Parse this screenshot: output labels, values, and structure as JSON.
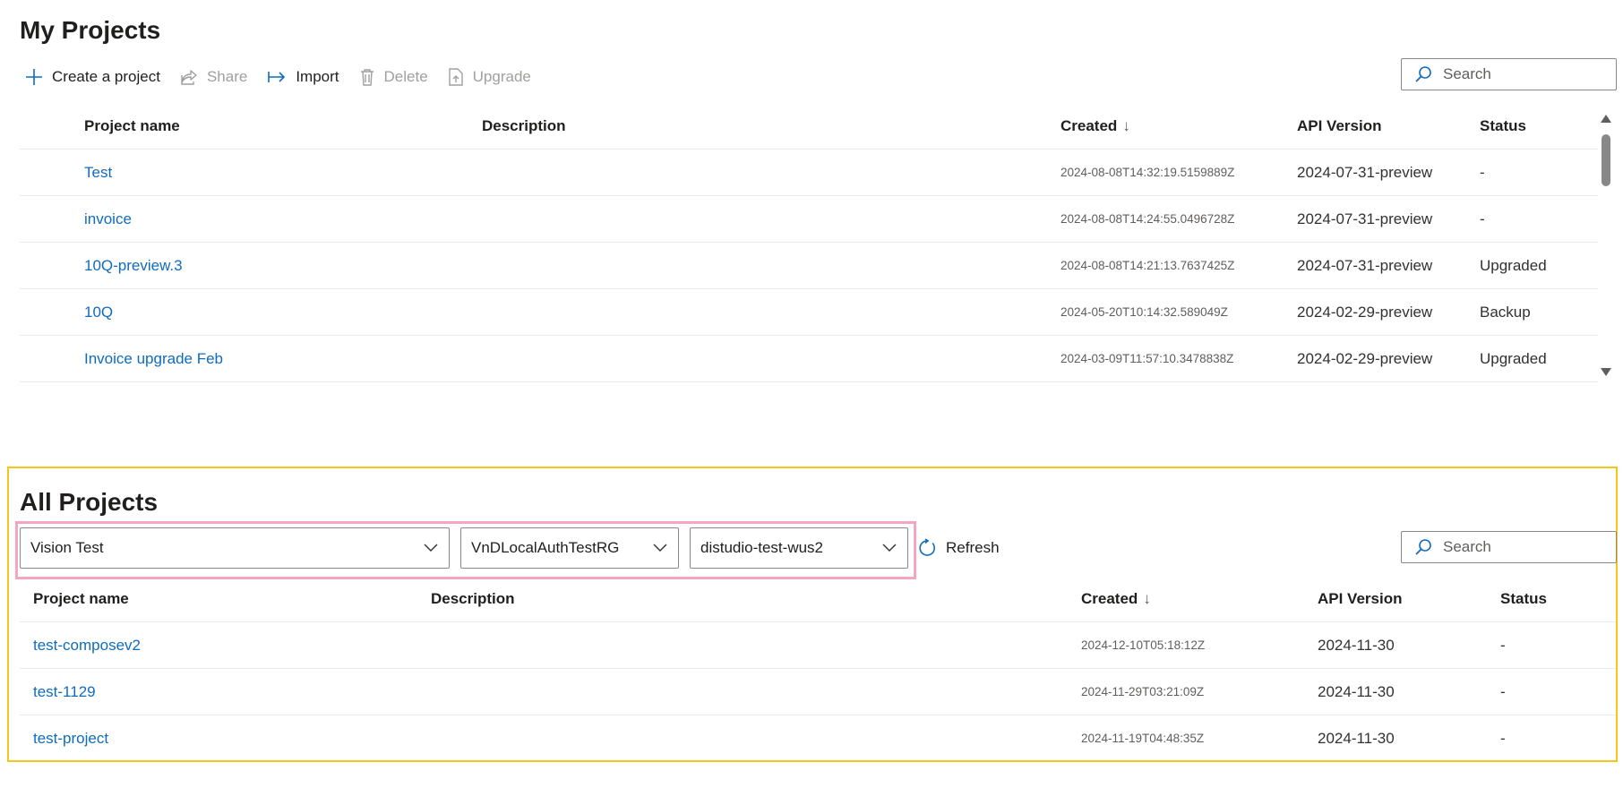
{
  "my_projects": {
    "title": "My Projects",
    "toolbar": {
      "create": "Create a project",
      "share": "Share",
      "import": "Import",
      "delete": "Delete",
      "upgrade": "Upgrade"
    },
    "search_placeholder": "Search",
    "columns": {
      "name": "Project name",
      "description": "Description",
      "created": "Created",
      "api_version": "API Version",
      "status": "Status"
    },
    "rows": [
      {
        "name": "Test",
        "description": "",
        "created": "2024-08-08T14:32:19.5159889Z",
        "api_version": "2024-07-31-preview",
        "status": "-"
      },
      {
        "name": "invoice",
        "description": "",
        "created": "2024-08-08T14:24:55.0496728Z",
        "api_version": "2024-07-31-preview",
        "status": "-"
      },
      {
        "name": "10Q-preview.3",
        "description": "",
        "created": "2024-08-08T14:21:13.7637425Z",
        "api_version": "2024-07-31-preview",
        "status": "Upgraded"
      },
      {
        "name": "10Q",
        "description": "",
        "created": "2024-05-20T10:14:32.589049Z",
        "api_version": "2024-02-29-preview",
        "status": "Backup"
      },
      {
        "name": "Invoice upgrade Feb",
        "description": "",
        "created": "2024-03-09T11:57:10.3478838Z",
        "api_version": "2024-02-29-preview",
        "status": "Upgraded"
      }
    ]
  },
  "all_projects": {
    "title": "All Projects",
    "filters": {
      "subscription": "Vision Test",
      "resource_group": "VnDLocalAuthTestRG",
      "resource": "distudio-test-wus2"
    },
    "refresh_label": "Refresh",
    "search_placeholder": "Search",
    "columns": {
      "name": "Project name",
      "description": "Description",
      "created": "Created",
      "api_version": "API Version",
      "status": "Status"
    },
    "rows": [
      {
        "name": "test-composev2",
        "description": "",
        "created": "2024-12-10T05:18:12Z",
        "api_version": "2024-11-30",
        "status": "-"
      },
      {
        "name": "test-1129",
        "description": "",
        "created": "2024-11-29T03:21:09Z",
        "api_version": "2024-11-30",
        "status": "-"
      },
      {
        "name": "test-project",
        "description": "",
        "created": "2024-11-19T04:48:35Z",
        "api_version": "2024-11-30",
        "status": "-"
      }
    ]
  },
  "icons": {
    "create": "plus-icon",
    "share": "share-icon",
    "import": "import-arrow-icon",
    "delete": "trash-icon",
    "upgrade": "upgrade-icon",
    "search": "search-icon",
    "sort": "arrow-down-icon",
    "dropdown": "chevron-down-icon",
    "refresh": "refresh-icon"
  },
  "colors": {
    "link": "#0f6cbd",
    "highlight_outer": "#f5c518",
    "highlight_inner": "#f4a6c0"
  }
}
